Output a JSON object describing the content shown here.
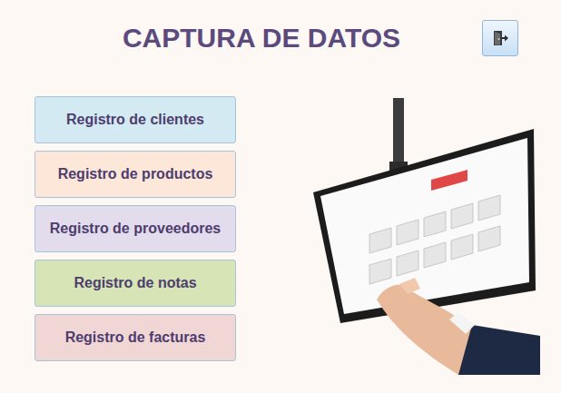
{
  "window": {
    "title": "CAPTURA DE DATOS"
  },
  "menu": [
    {
      "label": "Registro de clientes",
      "color": "#d3eaf3"
    },
    {
      "label": "Registro de productos",
      "color": "#fde7d9"
    },
    {
      "label": "Registro de proveedores",
      "color": "#e2dcec"
    },
    {
      "label": "Registro de notas",
      "color": "#d6e4b6"
    },
    {
      "label": "Registro de facturas",
      "color": "#f1d6d6"
    }
  ]
}
